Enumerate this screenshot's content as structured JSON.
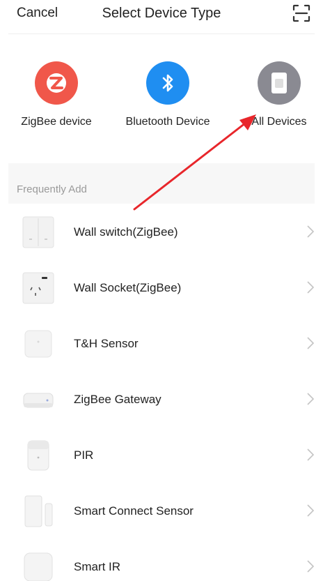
{
  "header": {
    "cancel_label": "Cancel",
    "title": "Select Device Type",
    "scan_icon": "scan-icon"
  },
  "categories": [
    {
      "label": "ZigBee device",
      "icon": "zigbee-icon",
      "color": "#f0574a"
    },
    {
      "label": "Bluetooth Device",
      "icon": "bluetooth-icon",
      "color": "#1f8ef1"
    },
    {
      "label": "All Devices",
      "icon": "all-devices-icon",
      "color": "#8a8a92"
    }
  ],
  "section": {
    "label": "Frequently Add"
  },
  "items": [
    {
      "name": "Wall switch(ZigBee)",
      "icon": "wall-switch-icon"
    },
    {
      "name": "Wall Socket(ZigBee)",
      "icon": "wall-socket-icon"
    },
    {
      "name": "T&H Sensor",
      "icon": "th-sensor-icon"
    },
    {
      "name": "ZigBee Gateway",
      "icon": "gateway-icon"
    },
    {
      "name": "PIR",
      "icon": "pir-icon"
    },
    {
      "name": "Smart Connect Sensor",
      "icon": "door-sensor-icon"
    },
    {
      "name": "Smart IR",
      "icon": "smart-ir-icon"
    }
  ],
  "annotation_color": "#e8262b"
}
